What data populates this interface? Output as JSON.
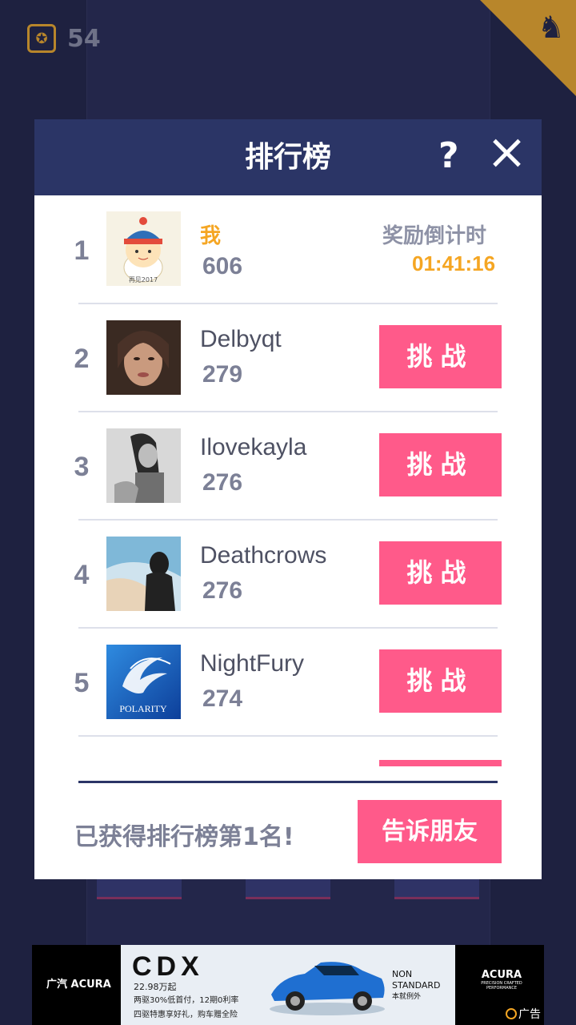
{
  "hud": {
    "coins": "54",
    "coin_icon": "dragon-coin-icon",
    "corner_icon": "dragon-icon"
  },
  "modal": {
    "title": "排行榜",
    "help_label": "?",
    "countdown_label": "奖励倒计时",
    "countdown_value": "01:41:16",
    "footer_message": "已获得排行榜第1名!",
    "share_label": "告诉朋友"
  },
  "rankings": [
    {
      "rank": "1",
      "name": "我",
      "score": "606",
      "is_me": true
    },
    {
      "rank": "2",
      "name": "Delbyqt",
      "score": "279",
      "challenge": "挑战"
    },
    {
      "rank": "3",
      "name": "Ilovekayla",
      "score": "276",
      "challenge": "挑战"
    },
    {
      "rank": "4",
      "name": "Deathcrows",
      "score": "276",
      "challenge": "挑战"
    },
    {
      "rank": "5",
      "name": "NightFury",
      "score": "274",
      "challenge": "挑战"
    }
  ],
  "avatar5_text": "POLARITY",
  "avatar1_text": "再见2017",
  "ad": {
    "left_brand": "广汽 ACURA",
    "model": "CDX",
    "price": "22.98万起",
    "line1": "两驱30%低首付，12期0利率",
    "line2": "四驱特惠享好礼，购车赠全险",
    "tagline": "NON STANDARD",
    "tagline_cn": "本就例外",
    "right_brand": "ACURA",
    "right_sub": "PRECISION CRAFTED PERFORMANCE",
    "ad_label": "广告"
  },
  "colors": {
    "accent": "#ff5a8a",
    "header": "#2b3566",
    "gold": "#f5a623",
    "background": "#1e2140"
  }
}
